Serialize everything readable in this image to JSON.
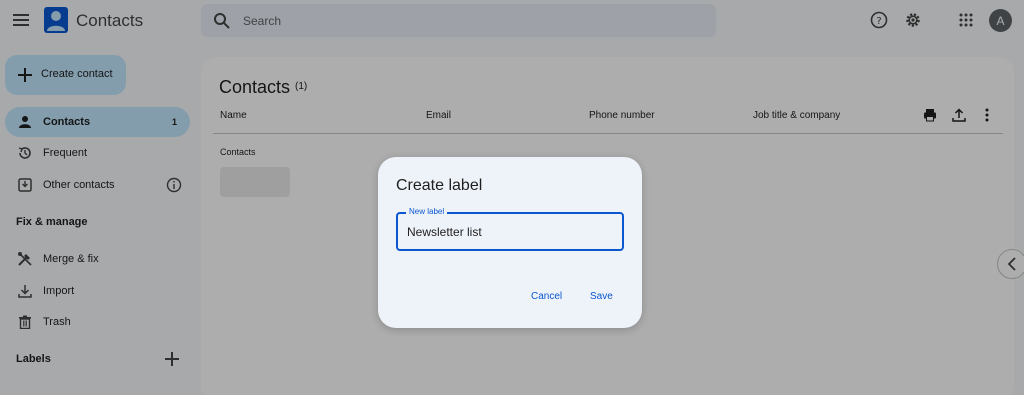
{
  "app": {
    "title": "Contacts"
  },
  "search": {
    "placeholder": "Search"
  },
  "account": {
    "initial": "A"
  },
  "sidebar": {
    "create_label": "Create contact",
    "items": [
      {
        "label": "Contacts",
        "count": "1"
      },
      {
        "label": "Frequent"
      },
      {
        "label": "Other contacts"
      }
    ],
    "fix_heading": "Fix & manage",
    "manage_items": [
      {
        "label": "Merge & fix"
      },
      {
        "label": "Import"
      },
      {
        "label": "Trash"
      }
    ],
    "labels_heading": "Labels"
  },
  "main": {
    "title": "Contacts",
    "count": "(1)",
    "columns": [
      "Name",
      "Email",
      "Phone number",
      "Job title & company"
    ],
    "group_label": "Contacts"
  },
  "dialog": {
    "title": "Create label",
    "field_label": "New label",
    "field_value": "Newsletter list",
    "cancel": "Cancel",
    "save": "Save"
  },
  "colors": {
    "accent": "#0b57d0",
    "selected": "#c2e7ff"
  }
}
